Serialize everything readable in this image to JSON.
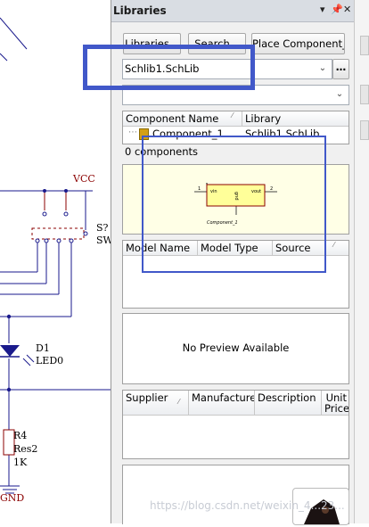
{
  "panel": {
    "title": "Libraries",
    "buttons": {
      "libraries": "Libraries...",
      "search": "Search...",
      "place": "Place Component_1"
    },
    "library_combo": {
      "value": "Schlib1.SchLib",
      "more": "…"
    },
    "filter_combo": {
      "value": ""
    }
  },
  "component_list": {
    "columns": [
      "Component Name",
      "Library"
    ],
    "rows": [
      {
        "name": "Component_1",
        "library": "Schlib1.SchLib"
      }
    ],
    "count_text": "0 components"
  },
  "symbol_preview": {
    "pin_left_number": "1",
    "pin_left_name": "vin",
    "pin_right_number": "2",
    "pin_right_name": "vout",
    "pin_bottom_name": "gnd",
    "caption": "Component_1"
  },
  "models": {
    "columns": [
      "Model Name",
      "Model Type",
      "Source"
    ]
  },
  "model_preview": {
    "text": "No Preview Available"
  },
  "suppliers": {
    "columns": [
      "Supplier",
      "Manufacturer",
      "Description",
      "Unit Price"
    ]
  },
  "schematic": {
    "vcc": "VCC",
    "switch_ref": "S?",
    "switch_name": "SW",
    "diode_ref": "D1",
    "diode_name": "LED0",
    "res_ref": "R4",
    "res_name": "Res2",
    "res_value": "1K",
    "gnd": "GND"
  },
  "watermark": "https://blog.csdn.net/weixin_4...23...",
  "colors": {
    "annotation_blue": "#4158c9",
    "schematic_wire": "#1a1a8c",
    "symbol_fill": "#ffff99",
    "symbol_border": "#8b0000",
    "preview_bg": "#ffffe6"
  }
}
